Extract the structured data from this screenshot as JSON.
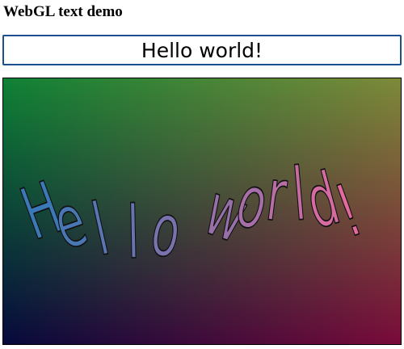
{
  "page": {
    "title": "WebGL text demo"
  },
  "input": {
    "value": "Hello world!"
  },
  "canvas": {
    "rendered_text": "Hello world!",
    "gradient_corners": {
      "top_left": "#0f8235",
      "top_right": "#7d8a39",
      "bottom_left": "#06093c",
      "bottom_right": "#7a0a3a"
    },
    "text_colors": {
      "start": "#3a78b6",
      "end": "#e46a9e",
      "outline": "#111111"
    }
  }
}
